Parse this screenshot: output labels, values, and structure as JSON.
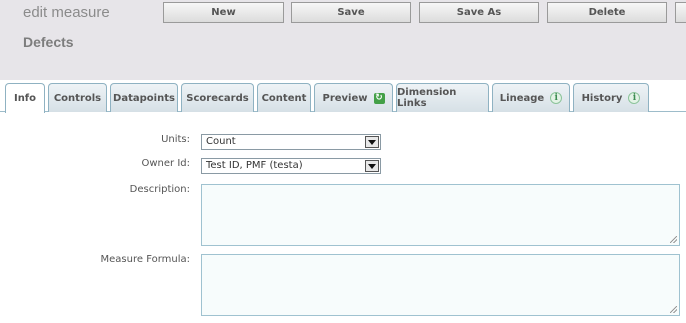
{
  "header": {
    "title": "edit measure",
    "subtitle": "Defects",
    "buttons": {
      "new": "New",
      "save": "Save",
      "save_as": "Save As",
      "delete": "Delete"
    }
  },
  "tabs": [
    {
      "label": "Info"
    },
    {
      "label": "Controls"
    },
    {
      "label": "Datapoints"
    },
    {
      "label": "Scorecards"
    },
    {
      "label": "Content"
    },
    {
      "label": "Preview"
    },
    {
      "label": "Dimension Links"
    },
    {
      "label": "Lineage"
    },
    {
      "label": "History"
    }
  ],
  "form": {
    "units": {
      "label": "Units:",
      "value": "Count"
    },
    "owner": {
      "label": "Owner Id:",
      "value": "Test ID, PMF (testa)"
    },
    "description": {
      "label": "Description:",
      "value": ""
    },
    "formula": {
      "label": "Measure Formula:",
      "value": ""
    }
  },
  "icons": {
    "info": "info-icon",
    "refresh": "refresh-icon",
    "dropdown": "chevron-down-icon"
  }
}
